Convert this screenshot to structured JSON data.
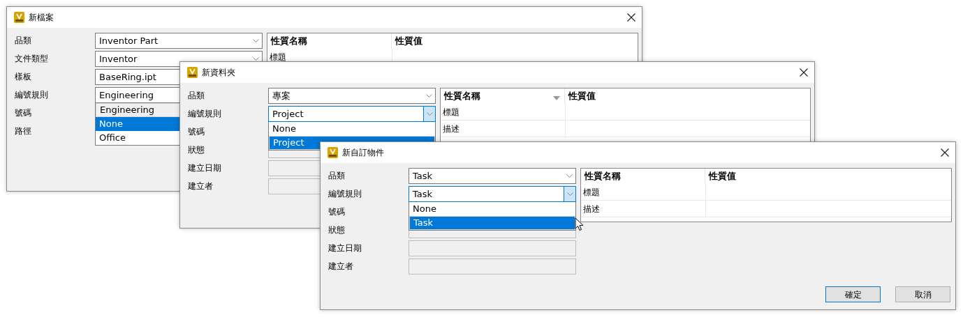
{
  "windows": [
    {
      "title": "新檔案",
      "fields": [
        {
          "label": "品類",
          "kind": "combo",
          "value": "Inventor Part"
        },
        {
          "label": "文件類型",
          "kind": "combo",
          "value": "Inventor"
        },
        {
          "label": "樣板",
          "kind": "text",
          "value": "BaseRing.ipt"
        },
        {
          "label": "編號規則",
          "kind": "combo",
          "value": "Engineering",
          "open": true,
          "options": [
            {
              "label": "Engineering",
              "selected": true,
              "highlighted": false
            },
            {
              "label": "None",
              "selected": false,
              "highlighted": true
            },
            {
              "label": "Office",
              "selected": false,
              "highlighted": false
            }
          ]
        },
        {
          "label": "號碼"
        },
        {
          "label": "路徑"
        }
      ],
      "grid": {
        "columns": [
          {
            "label": "性質名稱",
            "sorted": false
          },
          {
            "label": "性質值",
            "sorted": false
          }
        ],
        "rows": [
          {
            "name": "標題"
          }
        ]
      }
    },
    {
      "title": "新資料夾",
      "fields": [
        {
          "label": "品類",
          "kind": "combo",
          "value": "專案"
        },
        {
          "label": "編號規則",
          "kind": "combo",
          "value": "Project",
          "open": true,
          "focused": true,
          "options": [
            {
              "label": "None",
              "selected": false,
              "highlighted": false
            },
            {
              "label": "Project",
              "selected": true,
              "highlighted": true
            }
          ]
        },
        {
          "label": "號碼"
        },
        {
          "label": "狀態",
          "kind": "disabled"
        },
        {
          "label": "建立日期",
          "kind": "disabled"
        },
        {
          "label": "建立者",
          "kind": "disabled"
        }
      ],
      "grid": {
        "columns": [
          {
            "label": "性質名稱",
            "sorted": true
          },
          {
            "label": "性質值",
            "sorted": false
          }
        ],
        "rows": [
          {
            "name": "標題"
          },
          {
            "name": "描述"
          }
        ]
      }
    },
    {
      "title": "新自訂物件",
      "fields": [
        {
          "label": "品類",
          "kind": "combo",
          "value": "Task"
        },
        {
          "label": "編號規則",
          "kind": "combo",
          "value": "Task",
          "open": true,
          "focused": true,
          "options": [
            {
              "label": "None",
              "selected": false,
              "highlighted": false
            },
            {
              "label": "Task",
              "selected": true,
              "highlighted": true
            }
          ]
        },
        {
          "label": "號碼"
        },
        {
          "label": "狀態",
          "kind": "disabled"
        },
        {
          "label": "建立日期",
          "kind": "disabled"
        },
        {
          "label": "建立者",
          "kind": "disabled"
        }
      ],
      "grid": {
        "columns": [
          {
            "label": "性質名稱",
            "sorted": false
          },
          {
            "label": "性質值",
            "sorted": false
          }
        ],
        "rows": [
          {
            "name": "標題"
          },
          {
            "name": "描述"
          }
        ]
      },
      "buttons": [
        {
          "label": "確定",
          "default": true
        },
        {
          "label": "取消",
          "default": false
        }
      ]
    }
  ]
}
